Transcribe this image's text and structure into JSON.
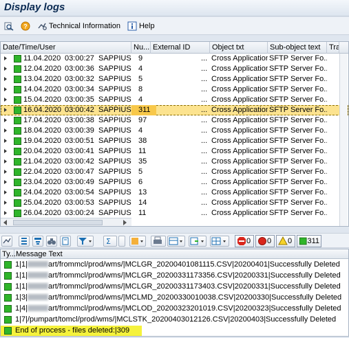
{
  "window": {
    "title": "Display logs"
  },
  "toolbar": {
    "buttons": [
      {
        "icon": "glasses-icon",
        "label": ""
      },
      {
        "icon": "help-question-icon",
        "label": ""
      },
      {
        "icon": "technical-info-icon",
        "label": "Technical Information"
      },
      {
        "icon": "info-icon",
        "label": "Help"
      }
    ]
  },
  "log_table": {
    "columns": [
      "Date/Time/User",
      "Nu...",
      "External ID",
      "Object txt",
      "Sub-object text",
      "Tran"
    ],
    "rows": [
      {
        "date": "11.04.2020",
        "time": "03:00:27",
        "user": "SAPPIUSE",
        "num": "9",
        "ext": "...",
        "obj": "Cross Application",
        "sub": "SFTP Server Fo...",
        "selected": false
      },
      {
        "date": "12.04.2020",
        "time": "03:00:36",
        "user": "SAPPIUSE",
        "num": "4",
        "ext": "...",
        "obj": "Cross Application",
        "sub": "SFTP Server Fo...",
        "selected": false
      },
      {
        "date": "13.04.2020",
        "time": "03:00:32",
        "user": "SAPPIUSE",
        "num": "5",
        "ext": "...",
        "obj": "Cross Application",
        "sub": "SFTP Server Fo...",
        "selected": false
      },
      {
        "date": "14.04.2020",
        "time": "03:00:34",
        "user": "SAPPIUSE",
        "num": "8",
        "ext": "...",
        "obj": "Cross Application",
        "sub": "SFTP Server Fo...",
        "selected": false
      },
      {
        "date": "15.04.2020",
        "time": "03:00:35",
        "user": "SAPPIUSE",
        "num": "4",
        "ext": "...",
        "obj": "Cross Application",
        "sub": "SFTP Server Fo...",
        "selected": false
      },
      {
        "date": "16.04.2020",
        "time": "03:00:42",
        "user": "SAPPIUSE",
        "num": "311",
        "ext": "...",
        "obj": "Cross Application",
        "sub": "SFTP Server Fo...",
        "selected": true
      },
      {
        "date": "17.04.2020",
        "time": "03:00:38",
        "user": "SAPPIUSE",
        "num": "97",
        "ext": "...",
        "obj": "Cross Application",
        "sub": "SFTP Server Fo...",
        "selected": false
      },
      {
        "date": "18.04.2020",
        "time": "03:00:39",
        "user": "SAPPIUSE",
        "num": "4",
        "ext": "...",
        "obj": "Cross Application",
        "sub": "SFTP Server Fo...",
        "selected": false
      },
      {
        "date": "19.04.2020",
        "time": "03:00:51",
        "user": "SAPPIUSE",
        "num": "38",
        "ext": "...",
        "obj": "Cross Application",
        "sub": "SFTP Server Fo...",
        "selected": false
      },
      {
        "date": "20.04.2020",
        "time": "03:00:41",
        "user": "SAPPIUSE",
        "num": "11",
        "ext": "...",
        "obj": "Cross Application",
        "sub": "SFTP Server Fo...",
        "selected": false
      },
      {
        "date": "21.04.2020",
        "time": "03:00:42",
        "user": "SAPPIUSE",
        "num": "35",
        "ext": "...",
        "obj": "Cross Application",
        "sub": "SFTP Server Fo...",
        "selected": false
      },
      {
        "date": "22.04.2020",
        "time": "03:00:47",
        "user": "SAPPIUSE",
        "num": "5",
        "ext": "...",
        "obj": "Cross Application",
        "sub": "SFTP Server Fo...",
        "selected": false
      },
      {
        "date": "23.04.2020",
        "time": "03:00:49",
        "user": "SAPPIUSE",
        "num": "6",
        "ext": "...",
        "obj": "Cross Application",
        "sub": "SFTP Server Fo...",
        "selected": false
      },
      {
        "date": "24.04.2020",
        "time": "03:00:54",
        "user": "SAPPIUSE",
        "num": "13",
        "ext": "...",
        "obj": "Cross Application",
        "sub": "SFTP Server Fo...",
        "selected": false
      },
      {
        "date": "25.04.2020",
        "time": "03:00:53",
        "user": "SAPPIUSE",
        "num": "14",
        "ext": "...",
        "obj": "Cross Application",
        "sub": "SFTP Server Fo...",
        "selected": false
      },
      {
        "date": "26.04.2020",
        "time": "03:00:24",
        "user": "SAPPIUSE",
        "num": "11",
        "ext": "...",
        "obj": "Cross Application",
        "sub": "SFTP Server Fo...",
        "selected": false
      }
    ]
  },
  "message_toolbar": {
    "error_count": "0",
    "stop_count": "0",
    "warning_count": "0",
    "success_count": "311"
  },
  "messages": {
    "columns": [
      "Ty...",
      "Message Text"
    ],
    "rows": [
      {
        "prefix": "1|1|",
        "text": "art/frommcl/prod/wms/|MCLGR_20200401081115.CSV|20200401|Successfully Deleted",
        "redacted": true
      },
      {
        "prefix": "1|1|",
        "text": "art/frommcl/prod/wms/|MCLGR_20200331173356.CSV|20200331|Successfully Deleted",
        "redacted": true
      },
      {
        "prefix": "1|1|",
        "text": "art/frommcl/prod/wms/|MCLGR_20200331173403.CSV|20200331|Successfully Deleted",
        "redacted": true
      },
      {
        "prefix": "1|3|",
        "text": "art/frommcl/prod/wms/|MCLMD_20200330010038.CSV|20200330|Successfully Deleted",
        "redacted": true
      },
      {
        "prefix": "1|4|",
        "text": "art/frommcl/prod/wms/|MCLOD_20200323201019.CSV|20200323|Successfully Deleted",
        "redacted": true
      },
      {
        "prefix": "1|7|",
        "text": "/pumpart/tomcl/prod/wms/|MCLSTK_20200403012126.CSV|20200403|Successfully Deleted",
        "redacted": false
      }
    ],
    "footer": "End of process - files deleted:|309"
  }
}
